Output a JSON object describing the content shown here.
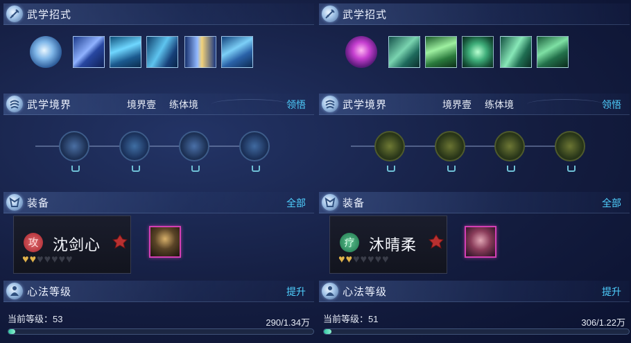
{
  "left": {
    "skills_header": {
      "title": "武学招式"
    },
    "realm_header": {
      "title": "武学境界",
      "realm_level": "境界壹",
      "realm_name": "练体境",
      "action": "领悟"
    },
    "equip_header": {
      "title": "装备",
      "action": "全部"
    },
    "character": {
      "badge": "攻",
      "name": "沈剑心",
      "hearts_filled": 2,
      "hearts_total": 7
    },
    "heart_method_header": {
      "title": "心法等级",
      "action": "提升"
    },
    "level_label": "当前等级：53",
    "progress_text": "290/1.34万",
    "progress_fraction": 0.022
  },
  "right": {
    "skills_header": {
      "title": "武学招式"
    },
    "realm_header": {
      "title": "武学境界",
      "realm_level": "境界壹",
      "realm_name": "练体境",
      "action": "领悟"
    },
    "equip_header": {
      "title": "装备",
      "action": "全部"
    },
    "character": {
      "badge": "疗",
      "name": "沐晴柔",
      "hearts_filled": 2,
      "hearts_total": 7
    },
    "heart_method_header": {
      "title": "心法等级",
      "action": "提升"
    },
    "level_label": "当前等级：51",
    "progress_text": "306/1.22万",
    "progress_fraction": 0.025
  },
  "colors": {
    "link": "#4fd0ff",
    "attack_badge": "#b8383f",
    "heal_badge": "#2f8a5e",
    "heart_on": "#e0b24a",
    "progress": "#5fe0bb"
  },
  "icons": {
    "header": "sword-icon",
    "realm": "swirl-icon",
    "equip": "armor-icon",
    "heart_method": "cultivator-icon",
    "lock": "lock-icon"
  }
}
